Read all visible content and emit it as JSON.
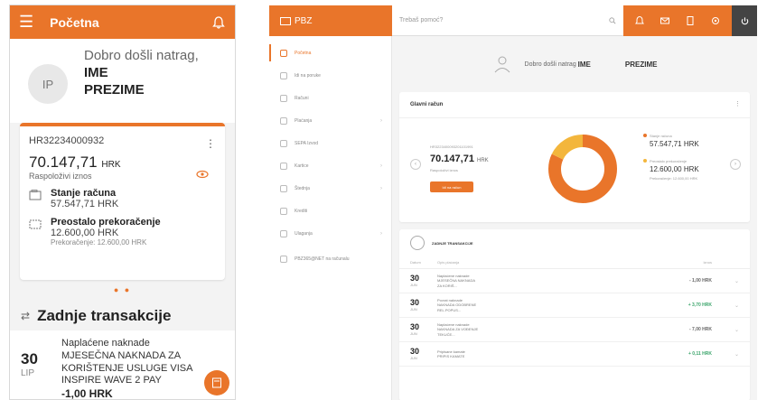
{
  "mobile": {
    "header_title": "Početna",
    "avatar_initials": "IP",
    "greeting": "Dobro došli natrag,",
    "first_name": "IME",
    "last_name": "PREZIME",
    "account": {
      "iban": "HR32234000932",
      "amount": "70.147,71",
      "currency": "HRK",
      "available_label": "Raspoloživi iznos",
      "balance_title": "Stanje računa",
      "balance_value": "57.547,71 HRK",
      "overdraft_title": "Preostalo prekoračenje",
      "overdraft_value": "12.600,00 HRK",
      "overdraft_limit": "Prekoračenje: 12.600,00 HRK"
    },
    "transactions_title": "Zadnje transakcije",
    "transaction": {
      "day": "30",
      "month": "LIP",
      "desc1": "Naplaćene naknade",
      "desc2": "MJESEČNA NAKNADA ZA",
      "desc3": "KORIŠTENJE USLUGE VISA",
      "desc4": "INSPIRE WAVE 2 PAY",
      "amount": "-1,00 HRK"
    }
  },
  "desktop": {
    "logo": "PBZ",
    "search_placeholder": "Trebaš pomoć?",
    "sidebar": [
      {
        "label": "Početna",
        "active": true
      },
      {
        "label": "Idi na poruke",
        "active": false
      },
      {
        "label": "Računi",
        "active": false
      },
      {
        "label": "Plaćanja",
        "active": false
      },
      {
        "label": "SEPA Izvod",
        "active": false
      },
      {
        "label": "Kartice",
        "active": false
      },
      {
        "label": "Štednja",
        "active": false
      },
      {
        "label": "Krediti",
        "active": false
      },
      {
        "label": "Ulaganja",
        "active": false
      },
      {
        "label": "PBZ365@NET na računalu",
        "active": false
      }
    ],
    "welcome_text": "Dobro došli natrag",
    "welcome_name": "IME",
    "welcome_surname": "PREZIME",
    "account_card": {
      "title": "Glavni račun",
      "iban": "HR3223400093201101991",
      "amount": "70.147,71",
      "currency": "HRK",
      "available": "Raspoloživi iznos",
      "button": "Idi na račun",
      "legend": [
        {
          "label": "Stanje računa",
          "value": "57.547,71 HRK",
          "color": "#e9752a"
        },
        {
          "label": "Preostalo prekoračenje",
          "value": "12.600,00 HRK",
          "color": "#f3b63c"
        }
      ],
      "overdraft_note": "Prekoračenje: 12.600,00 HRK"
    },
    "transactions": {
      "title": "ZADNJE TRANSAKCIJE",
      "col_date": "Datum",
      "col_desc": "Opis plaćanja",
      "col_amount": "Iznos",
      "rows": [
        {
          "day": "30",
          "month": "JUN",
          "d1": "Naplaćene naknade",
          "d2": "MJESEČNA NAKNADA",
          "d3": "ZA KORIŠ...",
          "amount": "- 1,00 HRK",
          "sign": "neg"
        },
        {
          "day": "30",
          "month": "JUN",
          "d1": "Povrat naknade",
          "d2": "NAKNADA ODOBRENE",
          "d3": "REL.POPUS...",
          "amount": "+ 3,70 HRK",
          "sign": "pos"
        },
        {
          "day": "30",
          "month": "JUN",
          "d1": "Naplaćene naknade",
          "d2": "NAKNADA ZA VOĐENJE",
          "d3": "TEKUĆE...",
          "amount": "- 7,00 HRK",
          "sign": "neg"
        },
        {
          "day": "30",
          "month": "JUN",
          "d1": "Pripisane kamate",
          "d2": "PRIPIS KAMATE",
          "d3": "",
          "amount": "+ 0,11 HRK",
          "sign": "pos"
        }
      ]
    }
  },
  "chart_data": {
    "type": "pie",
    "categories": [
      "Stanje računa",
      "Preostalo prekoračenje"
    ],
    "values": [
      57547.71,
      12600.0
    ]
  }
}
